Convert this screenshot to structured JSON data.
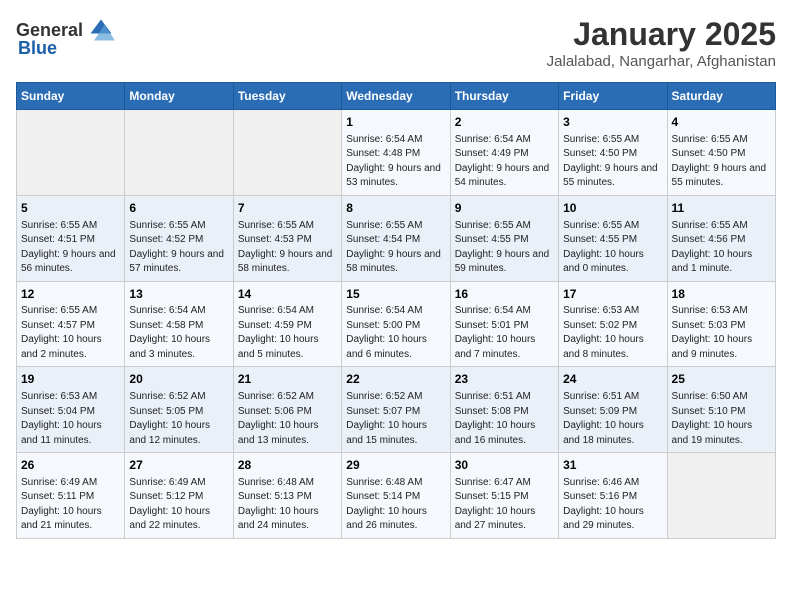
{
  "header": {
    "logo_general": "General",
    "logo_blue": "Blue",
    "title": "January 2025",
    "subtitle": "Jalalabad, Nangarhar, Afghanistan"
  },
  "days_of_week": [
    "Sunday",
    "Monday",
    "Tuesday",
    "Wednesday",
    "Thursday",
    "Friday",
    "Saturday"
  ],
  "weeks": [
    [
      {
        "day": "",
        "content": ""
      },
      {
        "day": "",
        "content": ""
      },
      {
        "day": "",
        "content": ""
      },
      {
        "day": "1",
        "content": "Sunrise: 6:54 AM\nSunset: 4:48 PM\nDaylight: 9 hours\nand 53 minutes."
      },
      {
        "day": "2",
        "content": "Sunrise: 6:54 AM\nSunset: 4:49 PM\nDaylight: 9 hours\nand 54 minutes."
      },
      {
        "day": "3",
        "content": "Sunrise: 6:55 AM\nSunset: 4:50 PM\nDaylight: 9 hours\nand 55 minutes."
      },
      {
        "day": "4",
        "content": "Sunrise: 6:55 AM\nSunset: 4:50 PM\nDaylight: 9 hours\nand 55 minutes."
      }
    ],
    [
      {
        "day": "5",
        "content": "Sunrise: 6:55 AM\nSunset: 4:51 PM\nDaylight: 9 hours\nand 56 minutes."
      },
      {
        "day": "6",
        "content": "Sunrise: 6:55 AM\nSunset: 4:52 PM\nDaylight: 9 hours\nand 57 minutes."
      },
      {
        "day": "7",
        "content": "Sunrise: 6:55 AM\nSunset: 4:53 PM\nDaylight: 9 hours\nand 58 minutes."
      },
      {
        "day": "8",
        "content": "Sunrise: 6:55 AM\nSunset: 4:54 PM\nDaylight: 9 hours\nand 58 minutes."
      },
      {
        "day": "9",
        "content": "Sunrise: 6:55 AM\nSunset: 4:55 PM\nDaylight: 9 hours\nand 59 minutes."
      },
      {
        "day": "10",
        "content": "Sunrise: 6:55 AM\nSunset: 4:55 PM\nDaylight: 10 hours\nand 0 minutes."
      },
      {
        "day": "11",
        "content": "Sunrise: 6:55 AM\nSunset: 4:56 PM\nDaylight: 10 hours\nand 1 minute."
      }
    ],
    [
      {
        "day": "12",
        "content": "Sunrise: 6:55 AM\nSunset: 4:57 PM\nDaylight: 10 hours\nand 2 minutes."
      },
      {
        "day": "13",
        "content": "Sunrise: 6:54 AM\nSunset: 4:58 PM\nDaylight: 10 hours\nand 3 minutes."
      },
      {
        "day": "14",
        "content": "Sunrise: 6:54 AM\nSunset: 4:59 PM\nDaylight: 10 hours\nand 5 minutes."
      },
      {
        "day": "15",
        "content": "Sunrise: 6:54 AM\nSunset: 5:00 PM\nDaylight: 10 hours\nand 6 minutes."
      },
      {
        "day": "16",
        "content": "Sunrise: 6:54 AM\nSunset: 5:01 PM\nDaylight: 10 hours\nand 7 minutes."
      },
      {
        "day": "17",
        "content": "Sunrise: 6:53 AM\nSunset: 5:02 PM\nDaylight: 10 hours\nand 8 minutes."
      },
      {
        "day": "18",
        "content": "Sunrise: 6:53 AM\nSunset: 5:03 PM\nDaylight: 10 hours\nand 9 minutes."
      }
    ],
    [
      {
        "day": "19",
        "content": "Sunrise: 6:53 AM\nSunset: 5:04 PM\nDaylight: 10 hours\nand 11 minutes."
      },
      {
        "day": "20",
        "content": "Sunrise: 6:52 AM\nSunset: 5:05 PM\nDaylight: 10 hours\nand 12 minutes."
      },
      {
        "day": "21",
        "content": "Sunrise: 6:52 AM\nSunset: 5:06 PM\nDaylight: 10 hours\nand 13 minutes."
      },
      {
        "day": "22",
        "content": "Sunrise: 6:52 AM\nSunset: 5:07 PM\nDaylight: 10 hours\nand 15 minutes."
      },
      {
        "day": "23",
        "content": "Sunrise: 6:51 AM\nSunset: 5:08 PM\nDaylight: 10 hours\nand 16 minutes."
      },
      {
        "day": "24",
        "content": "Sunrise: 6:51 AM\nSunset: 5:09 PM\nDaylight: 10 hours\nand 18 minutes."
      },
      {
        "day": "25",
        "content": "Sunrise: 6:50 AM\nSunset: 5:10 PM\nDaylight: 10 hours\nand 19 minutes."
      }
    ],
    [
      {
        "day": "26",
        "content": "Sunrise: 6:49 AM\nSunset: 5:11 PM\nDaylight: 10 hours\nand 21 minutes."
      },
      {
        "day": "27",
        "content": "Sunrise: 6:49 AM\nSunset: 5:12 PM\nDaylight: 10 hours\nand 22 minutes."
      },
      {
        "day": "28",
        "content": "Sunrise: 6:48 AM\nSunset: 5:13 PM\nDaylight: 10 hours\nand 24 minutes."
      },
      {
        "day": "29",
        "content": "Sunrise: 6:48 AM\nSunset: 5:14 PM\nDaylight: 10 hours\nand 26 minutes."
      },
      {
        "day": "30",
        "content": "Sunrise: 6:47 AM\nSunset: 5:15 PM\nDaylight: 10 hours\nand 27 minutes."
      },
      {
        "day": "31",
        "content": "Sunrise: 6:46 AM\nSunset: 5:16 PM\nDaylight: 10 hours\nand 29 minutes."
      },
      {
        "day": "",
        "content": ""
      }
    ]
  ]
}
